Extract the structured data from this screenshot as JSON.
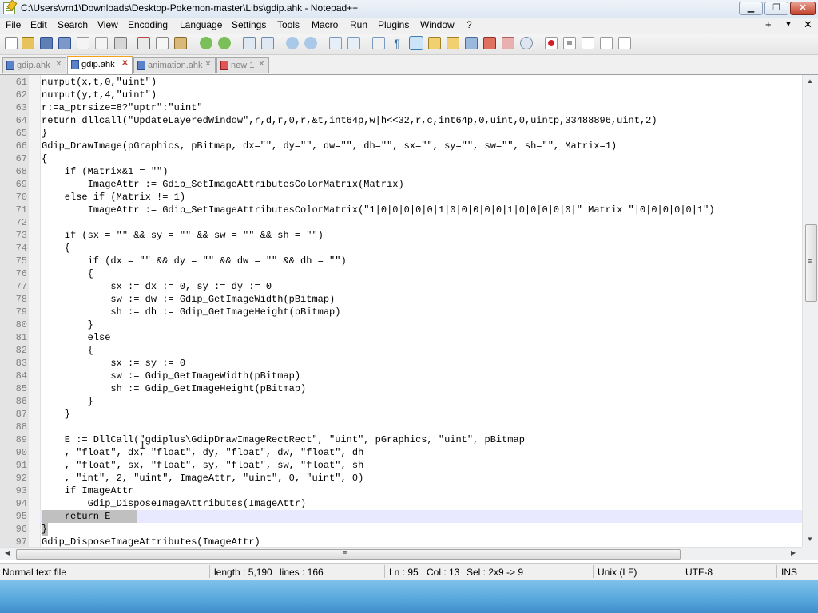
{
  "window": {
    "title": "C:\\Users\\vm1\\Downloads\\Desktop-Pokemon-master\\Libs\\gdip.ahk - Notepad++",
    "minimize_glyph": "▁",
    "restore_glyph": "❐",
    "close_glyph": "✕"
  },
  "menubar": {
    "items": [
      "File",
      "Edit",
      "Search",
      "View",
      "Encoding",
      "Language",
      "Settings",
      "Tools",
      "Macro",
      "Run",
      "Plugins",
      "Window",
      "?"
    ],
    "plus": "+",
    "dropdown": "▼",
    "close": "✕"
  },
  "toolbar": {
    "icons": [
      "new-file-icon",
      "open-file-icon",
      "save-icon",
      "save-all-icon",
      "close-icon",
      "close-all-icon",
      "print-icon",
      "cut-icon",
      "copy-icon",
      "paste-icon",
      "undo-icon",
      "redo-icon",
      "find-icon",
      "replace-icon",
      "zoom-in-icon",
      "zoom-out-icon",
      "sync-vertical-icon",
      "sync-horizontal-icon",
      "word-wrap-icon",
      "show-all-chars-icon",
      "indent-guide-icon",
      "doc-map-icon",
      "function-list-icon",
      "folder-workspace-icon",
      "monitoring-icon",
      "record-macro-icon",
      "stop-record-icon",
      "play-macro-icon",
      "run-macro-multiple-icon",
      "save-macro-icon"
    ]
  },
  "tabs": [
    {
      "label": "gdip.ahk",
      "active": false,
      "icon": "blue"
    },
    {
      "label": "gdip.ahk",
      "active": true,
      "icon": "blue"
    },
    {
      "label": "animation.ahk",
      "active": false,
      "icon": "blue"
    },
    {
      "label": "new 1",
      "active": false,
      "icon": "red"
    }
  ],
  "editor": {
    "lines": [
      {
        "num": "61",
        "text": "numput(x,t,0,\"uint\")"
      },
      {
        "num": "62",
        "text": "numput(y,t,4,\"uint\")"
      },
      {
        "num": "63",
        "text": "r:=a_ptrsize=8?\"uptr\":\"uint\""
      },
      {
        "num": "64",
        "text": "return dllcall(\"UpdateLayeredWindow\",r,d,r,0,r,&t,int64p,w|h<<32,r,c,int64p,0,uint,0,uintp,33488896,uint,2)"
      },
      {
        "num": "65",
        "text": "}"
      },
      {
        "num": "66",
        "text": "Gdip_DrawImage(pGraphics, pBitmap, dx=\"\", dy=\"\", dw=\"\", dh=\"\", sx=\"\", sy=\"\", sw=\"\", sh=\"\", Matrix=1)"
      },
      {
        "num": "67",
        "text": "{"
      },
      {
        "num": "68",
        "text": "    if (Matrix&1 = \"\")"
      },
      {
        "num": "69",
        "text": "        ImageAttr := Gdip_SetImageAttributesColorMatrix(Matrix)"
      },
      {
        "num": "70",
        "text": "    else if (Matrix != 1)"
      },
      {
        "num": "71",
        "text": "        ImageAttr := Gdip_SetImageAttributesColorMatrix(\"1|0|0|0|0|0|1|0|0|0|0|0|1|0|0|0|0|0|\" Matrix \"|0|0|0|0|0|1\")"
      },
      {
        "num": "72",
        "text": ""
      },
      {
        "num": "73",
        "text": "    if (sx = \"\" && sy = \"\" && sw = \"\" && sh = \"\")"
      },
      {
        "num": "74",
        "text": "    {"
      },
      {
        "num": "75",
        "text": "        if (dx = \"\" && dy = \"\" && dw = \"\" && dh = \"\")"
      },
      {
        "num": "76",
        "text": "        {"
      },
      {
        "num": "77",
        "text": "            sx := dx := 0, sy := dy := 0"
      },
      {
        "num": "78",
        "text": "            sw := dw := Gdip_GetImageWidth(pBitmap)"
      },
      {
        "num": "79",
        "text": "            sh := dh := Gdip_GetImageHeight(pBitmap)"
      },
      {
        "num": "80",
        "text": "        }"
      },
      {
        "num": "81",
        "text": "        else"
      },
      {
        "num": "82",
        "text": "        {"
      },
      {
        "num": "83",
        "text": "            sx := sy := 0"
      },
      {
        "num": "84",
        "text": "            sw := Gdip_GetImageWidth(pBitmap)"
      },
      {
        "num": "85",
        "text": "            sh := Gdip_GetImageHeight(pBitmap)"
      },
      {
        "num": "86",
        "text": "        }"
      },
      {
        "num": "87",
        "text": "    }"
      },
      {
        "num": "88",
        "text": ""
      },
      {
        "num": "89",
        "text": "    E := DllCall(\"gdiplus\\GdipDrawImageRectRect\", \"uint\", pGraphics, \"uint\", pBitmap"
      },
      {
        "num": "90",
        "text": "    , \"float\", dx, \"float\", dy, \"float\", dw, \"float\", dh"
      },
      {
        "num": "91",
        "text": "    , \"float\", sx, \"float\", sy, \"float\", sw, \"float\", sh"
      },
      {
        "num": "92",
        "text": "    , \"int\", 2, \"uint\", ImageAttr, \"uint\", 0, \"uint\", 0)"
      },
      {
        "num": "93",
        "text": "    if ImageAttr"
      },
      {
        "num": "94",
        "text": "        Gdip_DisposeImageAttributes(ImageAttr)"
      },
      {
        "num": "95",
        "text": "    return E"
      },
      {
        "num": "96",
        "text": "}"
      },
      {
        "num": "97",
        "text": "Gdip_DisposeImageAttributes(ImageAttr)"
      }
    ],
    "selected_lines": [
      "95",
      "96"
    ],
    "current_line": "95"
  },
  "scrollbars": {
    "up": "▲",
    "down": "▼",
    "left": "◀",
    "right": "▶",
    "grip": "≡"
  },
  "statusbar": {
    "file_type": "Normal text file",
    "length": "length : 5,190",
    "lines": "lines : 166",
    "ln": "Ln : 95",
    "col": "Col : 13",
    "sel": "Sel : 2x9 -> 9",
    "eol": "Unix (LF)",
    "encoding": "UTF-8",
    "mode": "INS"
  },
  "colors": {
    "accent_tab": "#f4a019",
    "selection": "#c0c0c0",
    "taskbar": "#5aa9dd"
  }
}
